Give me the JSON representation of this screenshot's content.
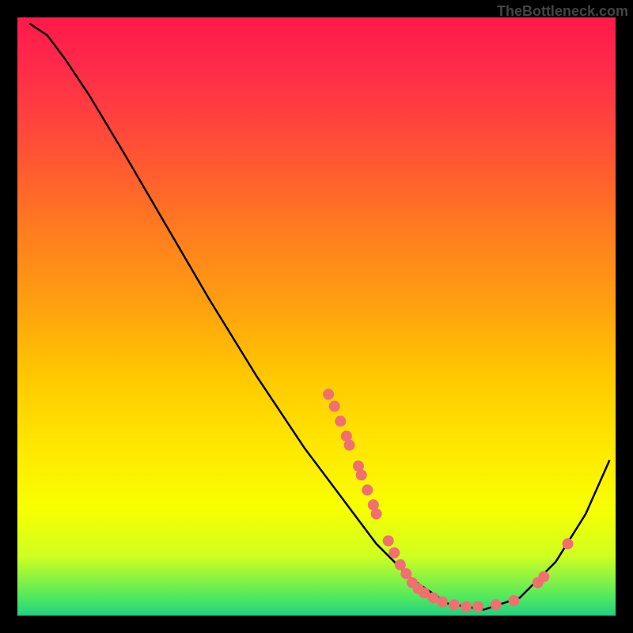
{
  "watermark": "TheBottleneck.com",
  "chart_data": {
    "type": "line",
    "title": "",
    "xlabel": "",
    "ylabel": "",
    "xlim": [
      0,
      100
    ],
    "ylim": [
      0,
      100
    ],
    "curve": [
      {
        "x": 2,
        "y": 99
      },
      {
        "x": 5,
        "y": 97
      },
      {
        "x": 8,
        "y": 93
      },
      {
        "x": 12,
        "y": 87
      },
      {
        "x": 18,
        "y": 77
      },
      {
        "x": 25,
        "y": 65
      },
      {
        "x": 32,
        "y": 53
      },
      {
        "x": 40,
        "y": 40
      },
      {
        "x": 48,
        "y": 28
      },
      {
        "x": 54,
        "y": 20
      },
      {
        "x": 60,
        "y": 12
      },
      {
        "x": 66,
        "y": 6
      },
      {
        "x": 72,
        "y": 2
      },
      {
        "x": 78,
        "y": 1
      },
      {
        "x": 84,
        "y": 3
      },
      {
        "x": 90,
        "y": 9
      },
      {
        "x": 95,
        "y": 17
      },
      {
        "x": 99,
        "y": 26
      }
    ],
    "scatter_points": [
      {
        "x": 52,
        "y": 37
      },
      {
        "x": 53,
        "y": 35
      },
      {
        "x": 54,
        "y": 32.5
      },
      {
        "x": 55,
        "y": 30
      },
      {
        "x": 55.5,
        "y": 28.5
      },
      {
        "x": 57,
        "y": 25
      },
      {
        "x": 57.5,
        "y": 23.5
      },
      {
        "x": 58.5,
        "y": 21
      },
      {
        "x": 59.5,
        "y": 18.5
      },
      {
        "x": 60,
        "y": 17
      },
      {
        "x": 62,
        "y": 12.5
      },
      {
        "x": 63,
        "y": 10.5
      },
      {
        "x": 64,
        "y": 8.5
      },
      {
        "x": 65,
        "y": 7
      },
      {
        "x": 66,
        "y": 5.5
      },
      {
        "x": 67,
        "y": 4.5
      },
      {
        "x": 68,
        "y": 3.8
      },
      {
        "x": 69.5,
        "y": 3
      },
      {
        "x": 71,
        "y": 2.3
      },
      {
        "x": 73,
        "y": 1.8
      },
      {
        "x": 75,
        "y": 1.5
      },
      {
        "x": 77,
        "y": 1.5
      },
      {
        "x": 80,
        "y": 1.8
      },
      {
        "x": 83,
        "y": 2.5
      },
      {
        "x": 87,
        "y": 5.5
      },
      {
        "x": 88,
        "y": 6.5
      },
      {
        "x": 92,
        "y": 12
      }
    ],
    "colors": {
      "curve": "#000000",
      "points": "#f07070",
      "gradient_top": "#ff1a4a",
      "gradient_bottom": "#20d080"
    }
  }
}
